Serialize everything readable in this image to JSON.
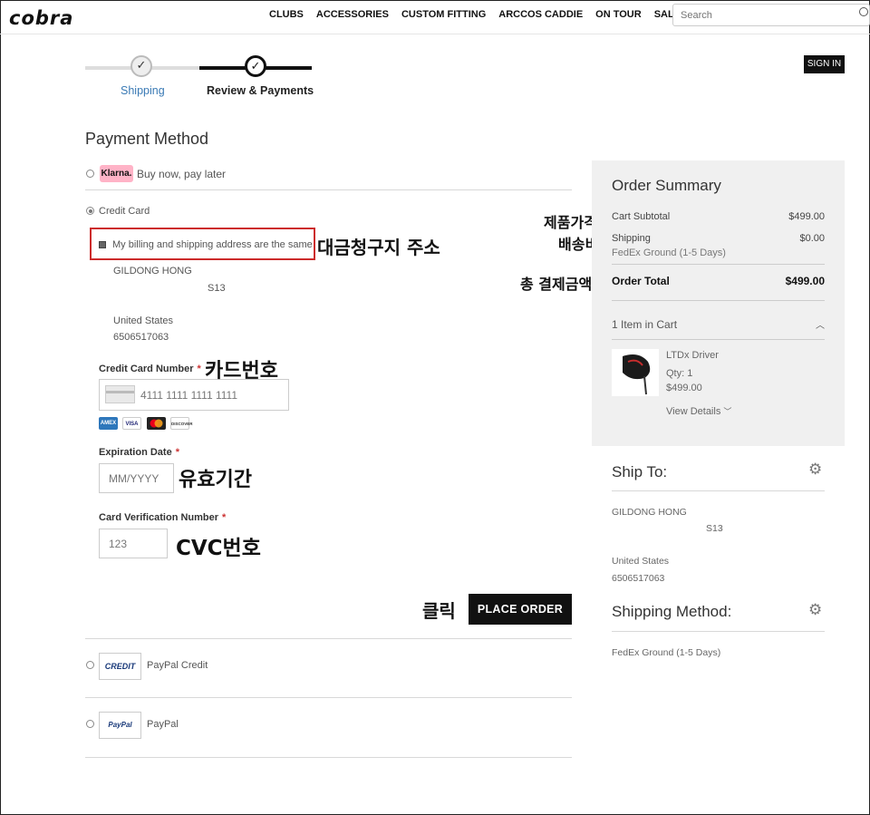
{
  "header": {
    "logo": "cobra",
    "nav": [
      "CLUBS",
      "ACCESSORIES",
      "CUSTOM FITTING",
      "ARCCOS CADDIE",
      "ON TOUR",
      "SALE"
    ],
    "search_placeholder": "Search"
  },
  "progress": {
    "step1": "Shipping",
    "step2": "Review & Payments",
    "sign_in": "SIGN IN"
  },
  "payment": {
    "title": "Payment Method",
    "klarna_badge": "Klarna.",
    "klarna_label": "Buy now, pay later",
    "credit_card_label": "Credit Card",
    "billing_same": "My billing and shipping address are the same",
    "address": {
      "name": "GILDONG HONG",
      "line": "S13",
      "country": "United States",
      "phone": "6506517063"
    },
    "card_number_label": "Credit Card Number",
    "card_number_value": "4111 1111 1111 1111",
    "card_brands": [
      "AMEX",
      "VISA",
      "MC",
      "DISCOVER"
    ],
    "expiration_label": "Expiration Date",
    "expiration_placeholder": "MM/YYYY",
    "cvv_label": "Card Verification Number",
    "cvv_value": "123",
    "required_mark": "*",
    "place_order": "PLACE ORDER",
    "paypal_credit_label": "PayPal Credit",
    "paypal_credit_logo": "CREDIT",
    "paypal_label": "PayPal",
    "paypal_logo": "PayPal"
  },
  "annotations": {
    "billing": "대금청구지 주소",
    "card_number": "카드번호",
    "expiration": "유효기간",
    "cvc": "CVC번호",
    "click": "클릭",
    "product_price": "제품가격",
    "shipping_fee": "배송비",
    "total_amount": "총 결제금액"
  },
  "summary": {
    "title": "Order Summary",
    "subtotal_label": "Cart Subtotal",
    "subtotal_value": "$499.00",
    "shipping_label": "Shipping",
    "shipping_value": "$0.00",
    "shipping_method": "FedEx Ground (1-5 Days)",
    "total_label": "Order Total",
    "total_value": "$499.00",
    "items_in_cart": "1 Item in Cart",
    "item": {
      "name": "LTDx Driver",
      "qty": "Qty: 1",
      "price": "$499.00",
      "details": "View Details"
    }
  },
  "ship_to": {
    "title": "Ship To:",
    "name": "GILDONG HONG",
    "line": "S13",
    "country": "United States",
    "phone": "6506517063"
  },
  "shipping_method": {
    "title": "Shipping Method:",
    "value": "FedEx Ground (1-5 Days)"
  }
}
